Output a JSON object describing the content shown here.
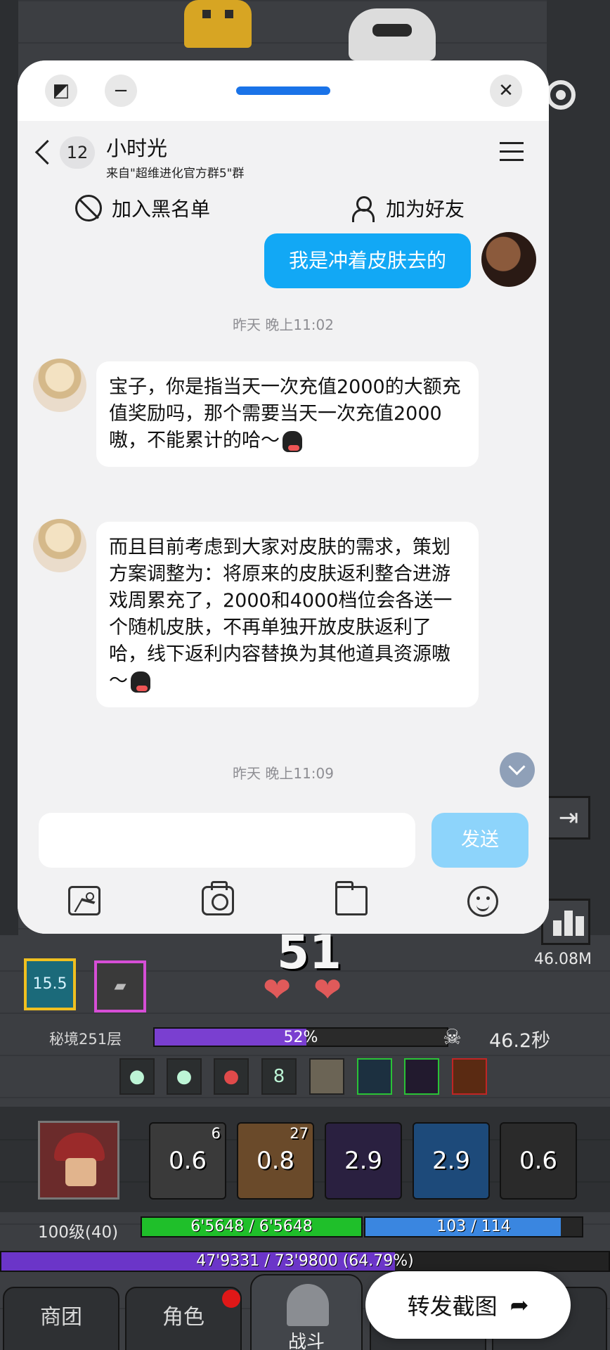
{
  "chat": {
    "unread_count": "12",
    "contact_name": "小时光",
    "contact_source": "来自\"超维进化官方群5\"群",
    "block_label": "加入黑名单",
    "add_friend_label": "加为好友",
    "messages": [
      {
        "direction": "out",
        "text": "我是冲着皮肤去的"
      },
      {
        "direction": "time",
        "text": "昨天 晚上11:02"
      },
      {
        "direction": "in",
        "text": "宝子，你是指当天一次充值2000的大额充值奖励吗，那个需要当天一次充值2000嗷，不能累计的哈～"
      },
      {
        "direction": "in",
        "text": "而且目前考虑到大家对皮肤的需求，策划方案调整为：将原来的皮肤返利整合进游戏周累充了，2000和4000档位会各送一个随机皮肤，不再单独开放皮肤返利了哈，线下返利内容替换为其他道具资源嗷～"
      },
      {
        "direction": "time",
        "text": "昨天 晚上11:09"
      }
    ],
    "input_placeholder": "",
    "send_label": "发送",
    "accent_color": "#12a8f5"
  },
  "game": {
    "stats_value": "46.08M",
    "combo_count": "51",
    "slot_item_label": "15.5",
    "realm_label": "秘境251层",
    "realm_progress_text": "52%",
    "realm_progress": 0.52,
    "realm_time": "46.2秒",
    "buff_num": "8",
    "skills": [
      {
        "value": "0.6",
        "badge": "6"
      },
      {
        "value": "0.8",
        "badge": "27"
      },
      {
        "value": "2.9",
        "badge": ""
      },
      {
        "value": "2.9",
        "badge": ""
      },
      {
        "value": "0.6",
        "badge": ""
      }
    ],
    "level_label": "100级(40)",
    "hp_text": "6'5648 / 6'5648",
    "mp_text": "103 / 114",
    "mp_progress": 0.9035,
    "exp_text": "47'9331 / 73'9800 (64.79%)",
    "exp_progress": 0.6479,
    "tabs": {
      "shop": "商团",
      "role": "角色",
      "battle": "战斗"
    }
  },
  "overlay": {
    "forward_label": "转发截图"
  }
}
